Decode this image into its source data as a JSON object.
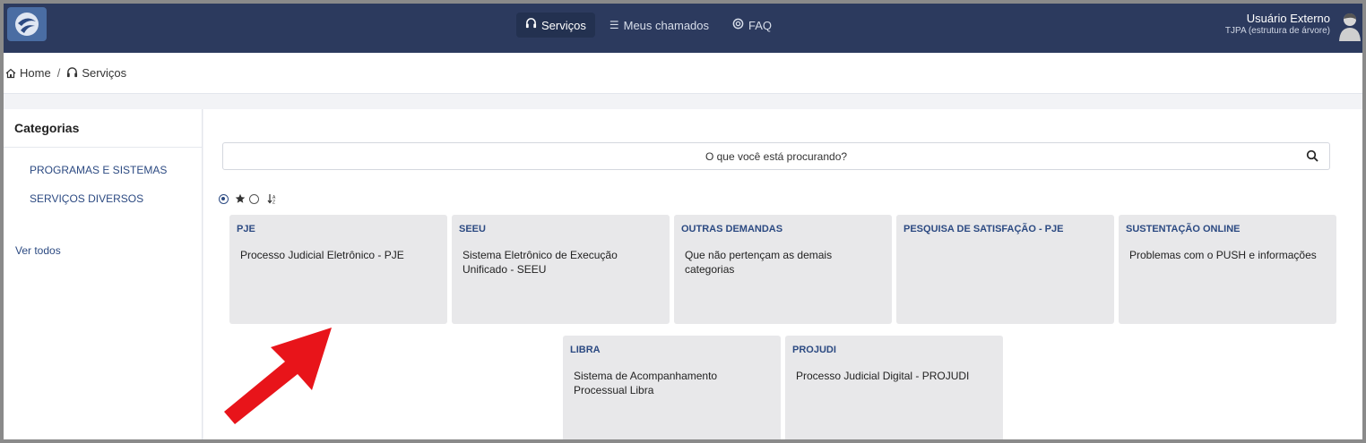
{
  "header": {
    "nav": [
      {
        "label": "Serviços",
        "icon": "headset-icon"
      },
      {
        "label": "Meus chamados",
        "icon": "list-icon"
      },
      {
        "label": "FAQ",
        "icon": "lifebuoy-icon"
      }
    ],
    "user": {
      "name": "Usuário Externo",
      "org": "TJPA (estrutura de árvore)"
    }
  },
  "breadcrumb": {
    "home": "Home",
    "separator": "/",
    "current": "Serviços"
  },
  "sidebar": {
    "title": "Categorias",
    "categories": [
      "PROGRAMAS E SISTEMAS",
      "SERVIÇOS DIVERSOS"
    ],
    "view_all": "Ver todos"
  },
  "search": {
    "placeholder": "O que você está procurando?"
  },
  "filters": {
    "icons": [
      "radio-selected",
      "star-icon",
      "radio-unselected",
      "sort-icon"
    ]
  },
  "cards": [
    {
      "title": "PJE",
      "description": "Processo Judicial Eletrônico - PJE"
    },
    {
      "title": "SEEU",
      "description": "Sistema Eletrônico de Execução Unificado - SEEU"
    },
    {
      "title": "OUTRAS DEMANDAS",
      "description": "Que não pertençam as demais categorias"
    },
    {
      "title": "PESQUISA DE SATISFAÇÃO - PJE",
      "description": ""
    },
    {
      "title": "SUSTENTAÇÃO ONLINE",
      "description": "Problemas com o PUSH e informações"
    },
    {
      "title": "LIBRA",
      "description": "Sistema de Acompanhamento Processual Libra"
    },
    {
      "title": "PROJUDI",
      "description": "Processo Judicial Digital - PROJUDI"
    }
  ],
  "colors": {
    "topbar": "#2c3a5e",
    "link": "#2c4a82",
    "card": "#e8e8ea",
    "annotation_arrow": "#e8141a"
  }
}
